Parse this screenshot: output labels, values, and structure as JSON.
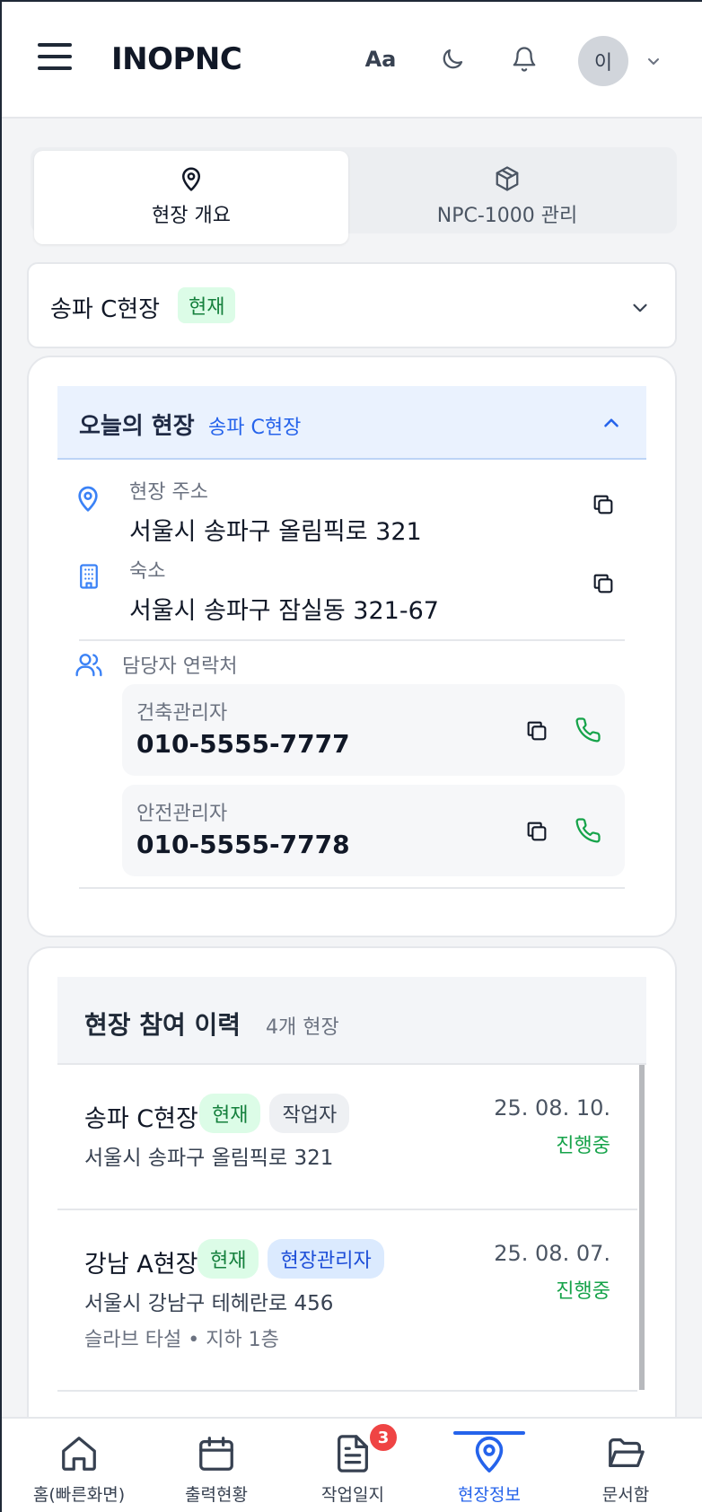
{
  "header": {
    "brand": "INOPNC",
    "font_toggle": "Aa",
    "avatar_initial": "이"
  },
  "tabs": [
    {
      "label": "현장 개요",
      "icon": "map-pin-icon",
      "active": true
    },
    {
      "label": "NPC-1000 관리",
      "icon": "package-icon",
      "active": false
    }
  ],
  "site_select": {
    "name": "송파 C현장",
    "badge": "현재"
  },
  "today": {
    "title": "오늘의 현장",
    "site": "송파 C현장",
    "address_label": "현장 주소",
    "address": "서울시 송파구 올림픽로 321",
    "lodging_label": "숙소",
    "lodging": "서울시 송파구 잠실동 321-67",
    "contacts_label": "담당자 연락처",
    "contacts": [
      {
        "role": "건축관리자",
        "phone": "010-5555-7777"
      },
      {
        "role": "안전관리자",
        "phone": "010-5555-7778"
      }
    ]
  },
  "history": {
    "title": "현장 참여 이력",
    "count": "4개 현장",
    "items": [
      {
        "name": "송파 C현장",
        "badges": [
          "현재",
          "작업자"
        ],
        "address": "서울시 송파구 올림픽로 321",
        "date": "25. 08. 10.",
        "status": "진행중"
      },
      {
        "name": "강남 A현장",
        "badges": [
          "현재",
          "현장관리자"
        ],
        "address": "서울시 강남구 테헤란로 456",
        "detail_work": "슬라브 타설",
        "detail_dot": "•",
        "detail_floor": "지하 1층",
        "date": "25. 08. 07.",
        "status": "진행중"
      }
    ]
  },
  "bottom_nav": [
    {
      "label": "홈(빠른화면)",
      "icon": "home-icon"
    },
    {
      "label": "출력현황",
      "icon": "calendar-icon"
    },
    {
      "label": "작업일지",
      "icon": "document-icon",
      "badge": "3"
    },
    {
      "label": "현장정보",
      "icon": "map-pin-icon",
      "active": true
    },
    {
      "label": "문서함",
      "icon": "folder-icon"
    }
  ],
  "colors": {
    "accent": "#2563eb",
    "success": "#16a34a",
    "badge_red": "#ef4444"
  }
}
